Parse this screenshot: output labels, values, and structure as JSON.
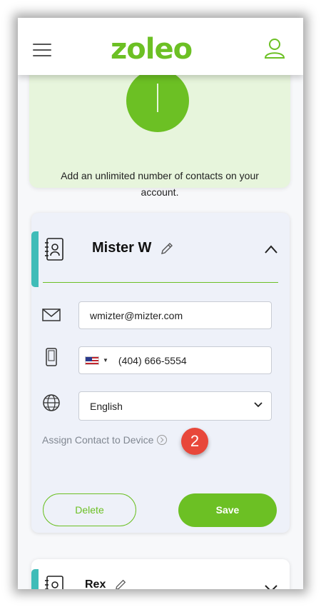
{
  "header": {
    "logo_text": "zoleo",
    "menu_icon": "hamburger-icon",
    "account_icon": "user-icon"
  },
  "promo": {
    "text": "Add an unlimited number of contacts on your account."
  },
  "contact": {
    "name": "Mister W",
    "email": "wmizter@mizter.com",
    "phone": "(404) 666-5554",
    "country_flag": "US",
    "language": "English",
    "assign_link": "Assign Contact to Device",
    "callout_number": "2",
    "delete_label": "Delete",
    "save_label": "Save"
  },
  "contact2": {
    "name": "Rex"
  },
  "colors": {
    "brand_green": "#6cc024",
    "accent_teal": "#3fbcb8",
    "callout_red": "#e8473a",
    "promo_bg": "#e7f5dc",
    "card_bg": "#eef1f9"
  }
}
